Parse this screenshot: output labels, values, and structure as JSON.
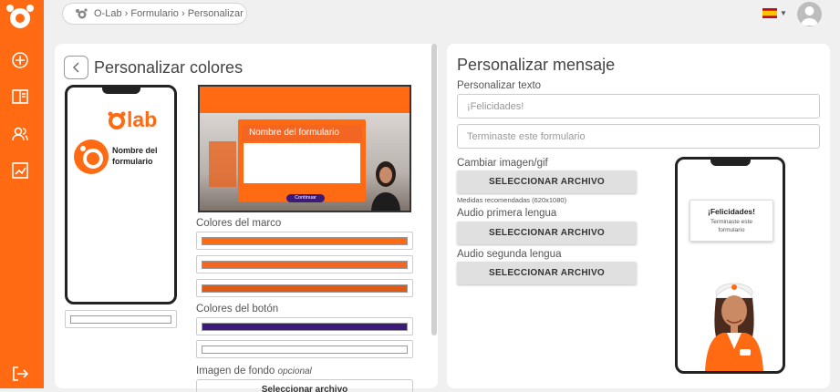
{
  "colors": {
    "accent": "#ff6a13",
    "button_purple": "#3c1a78"
  },
  "sidebar": {
    "icons": [
      "logo-icon",
      "add-icon",
      "book-icon",
      "users-icon",
      "analytics-icon",
      "logout-icon"
    ]
  },
  "breadcrumb": {
    "text": "O-Lab › Formulario › Personalizar"
  },
  "left_panel": {
    "title": "Personalizar colores",
    "phone_brand": "lab",
    "form_name": "Nombre del formulario",
    "preview_title": "Nombre del formulario",
    "preview_button": "Continuar",
    "frame_colors_label": "Colores del marco",
    "frame_colors": [
      "#ff6a13",
      "#f26522",
      "#e05a17"
    ],
    "button_colors_label": "Colores del botón",
    "button_colors": [
      "#3c1a78",
      "#ffffff"
    ],
    "bg_image_label": "Imagen de fondo",
    "bg_image_optional": "opcional",
    "bg_button_partial": "Seleccionar archivo"
  },
  "right_panel": {
    "title": "Personalizar mensaje",
    "customize_text_label": "Personalizar texto",
    "input1_placeholder": "¡Felicidades!",
    "input2_placeholder": "Terminaste este formulario",
    "change_image_label": "Cambiar imagen/gif",
    "select_file": "SELECCIONAR ARCHIVO",
    "recommended": "Medidas recomendadas (620x1080)",
    "audio1_label": "Audio primera lengua",
    "audio2_label": "Audio segunda lengua",
    "bubble_title": "¡Felicidades!",
    "bubble_text": "Terminaste este formulario"
  }
}
